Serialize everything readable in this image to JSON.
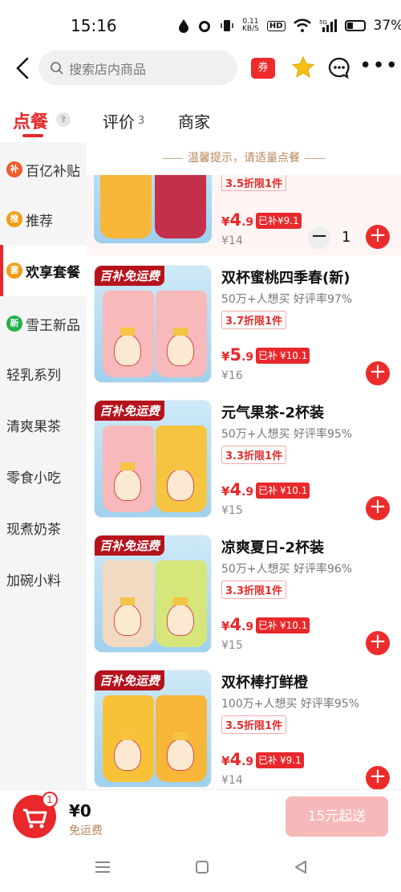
{
  "status_bar": {
    "time": "15:16",
    "net_speed": "0.11\nKB/S",
    "hd": "HD",
    "signal": "5G",
    "battery": "37%"
  },
  "header": {
    "search_placeholder": "搜索店内商品",
    "coupon_label": "券"
  },
  "tabs": {
    "order": "点餐",
    "reviews": "评价",
    "reviews_count": "3",
    "merchant": "商家"
  },
  "sidebar": {
    "items": [
      {
        "label": "百亿补贴",
        "badge": "补",
        "badge_color": "#f05a28"
      },
      {
        "label": "推荐",
        "badge": "推",
        "badge_color": "#f39c12"
      },
      {
        "label": "欢享套餐",
        "badge": "套",
        "badge_color": "#f39c12"
      },
      {
        "label": "雪王新品",
        "badge": "新",
        "badge_color": "#21b14a"
      },
      {
        "label": "轻乳系列"
      },
      {
        "label": "清爽果茶"
      },
      {
        "label": "零食小吃"
      },
      {
        "label": "现煮奶茶"
      },
      {
        "label": "加碗小料"
      }
    ]
  },
  "tip": "温馨提示，请适量点餐",
  "first_product": {
    "discount": "3.5折限1件",
    "price_cur": "¥",
    "price_int": "4",
    "price_dec": ".9",
    "subsidy_label": "已补",
    "subsidy_value": "¥9.1",
    "orig": "¥14",
    "qty": "1"
  },
  "products": [
    {
      "banner": "百补免运费",
      "name": "双杯蜜桃四季春(新)",
      "meta": "50万+人想买  好评率97%",
      "discount": "3.7折限1件",
      "price_cur": "¥",
      "price_int": "5",
      "price_dec": ".9",
      "subsidy_label": "已补",
      "subsidy_value": "¥10.1",
      "orig": "¥16",
      "cup_colors": [
        "#f7b9b9",
        "#f7b9b9"
      ]
    },
    {
      "banner": "百补免运费",
      "name": "元气果茶-2杯装",
      "meta": "50万+人想买  好评率95%",
      "discount": "3.3折限1件",
      "price_cur": "¥",
      "price_int": "4",
      "price_dec": ".9",
      "subsidy_label": "已补",
      "subsidy_value": "¥10.1",
      "orig": "¥15",
      "cup_colors": [
        "#f7b9b9",
        "#f5c542"
      ]
    },
    {
      "banner": "百补免运费",
      "name": "凉爽夏日-2杯装",
      "meta": "50万+人想买  好评率96%",
      "discount": "3.3折限1件",
      "price_cur": "¥",
      "price_int": "4",
      "price_dec": ".9",
      "subsidy_label": "已补",
      "subsidy_value": "¥10.1",
      "orig": "¥15",
      "cup_colors": [
        "#f1d9c2",
        "#d6e67a"
      ]
    },
    {
      "banner": "百补免运费",
      "name": "双杯棒打鲜橙",
      "meta": "100万+人想买  好评率95%",
      "discount": "3.5折限1件",
      "price_cur": "¥",
      "price_int": "4",
      "price_dec": ".9",
      "subsidy_label": "已补",
      "subsidy_value": "¥9.1",
      "orig": "¥14",
      "cup_colors": [
        "#f7c238",
        "#f7b638"
      ]
    }
  ],
  "bottom": {
    "cart_count": "1",
    "total": "¥0",
    "free_ship": "免运费",
    "checkout": "15元起送"
  },
  "colors": {
    "accent": "#e8282b",
    "tip": "#b7875a",
    "checkout_disabled": "#f6b8b8"
  }
}
